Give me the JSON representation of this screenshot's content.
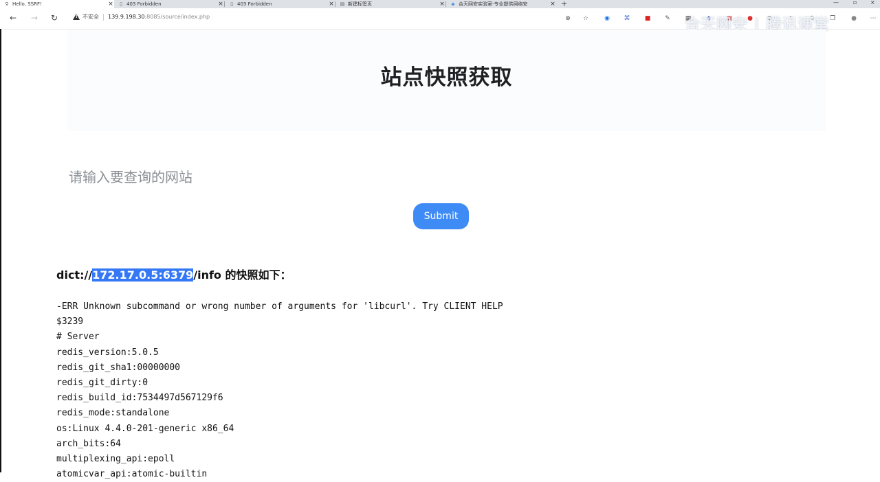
{
  "browser": {
    "tabs": [
      {
        "title": "Hello, SSRF!",
        "active": true
      },
      {
        "title": "403 Forbidden",
        "active": false
      },
      {
        "title": "403 Forbidden",
        "active": false
      },
      {
        "title": "新建标签页",
        "active": false
      },
      {
        "title": "合天网安实验室-专业提供网络安",
        "active": false
      }
    ],
    "new_tab_symbol": "+",
    "security_label": "不安全",
    "url_host": "139.9.198.30",
    "url_rest": ":8085/source/index.php",
    "watermark": "合天网安 | 腾讯课堂"
  },
  "page": {
    "title": "站点快照获取",
    "input_placeholder": "请输入要查询的网站",
    "submit_label": "Submit",
    "result": {
      "prefix": "dict://",
      "highlighted": "172.17.0.5:6379",
      "suffix": "/info 的快照如下：",
      "lines": [
        "-ERR Unknown subcommand or wrong number of arguments for 'libcurl'. Try CLIENT HELP",
        "$3239",
        "# Server",
        "redis_version:5.0.5",
        "redis_git_sha1:00000000",
        "redis_git_dirty:0",
        "redis_build_id:7534497d567129f6",
        "redis_mode:standalone",
        "os:Linux 4.4.0-201-generic x86_64",
        "arch_bits:64",
        "multiplexing_api:epoll",
        "atomicvar_api:atomic-builtin"
      ]
    }
  },
  "colors": {
    "accent": "#3f8bf6",
    "selection": "#3478f6"
  }
}
